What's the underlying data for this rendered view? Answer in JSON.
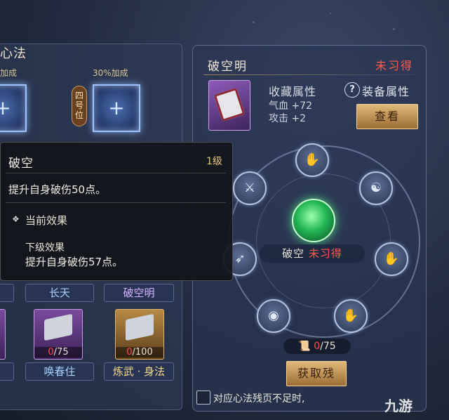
{
  "left_panel": {
    "title": "心法",
    "bonus_left": "加成",
    "bonus_right": "30%加成",
    "position_tag": "四号位",
    "slot_plus": "+",
    "names": [
      "长天",
      "破空明"
    ],
    "books": [
      {
        "current": "0",
        "total": "/75",
        "name": "唤春住"
      },
      {
        "current": "0",
        "total": "/100",
        "name": "炼武 · 身法"
      }
    ]
  },
  "tooltip": {
    "title": "破空",
    "level": "1级",
    "description": "提升自身破伤50点。",
    "current_effect": "当前效果",
    "next_title": "下级效果",
    "next_description": "提升自身破伤57点。"
  },
  "right_panel": {
    "skill_name": "破空明",
    "status": "未习得",
    "collect_attr": "收藏属性",
    "stats": [
      "气血 +72",
      "攻击 +2"
    ],
    "help": "?",
    "equip_attr": "装备属性",
    "view_button": "查看",
    "center_name": "破空",
    "center_status": "未习得",
    "fragments_current": "0",
    "fragments_total": "/75",
    "obtain_button": "获取残",
    "checkbox_text": "对应心法残页不足时,",
    "watermark": "九游"
  }
}
